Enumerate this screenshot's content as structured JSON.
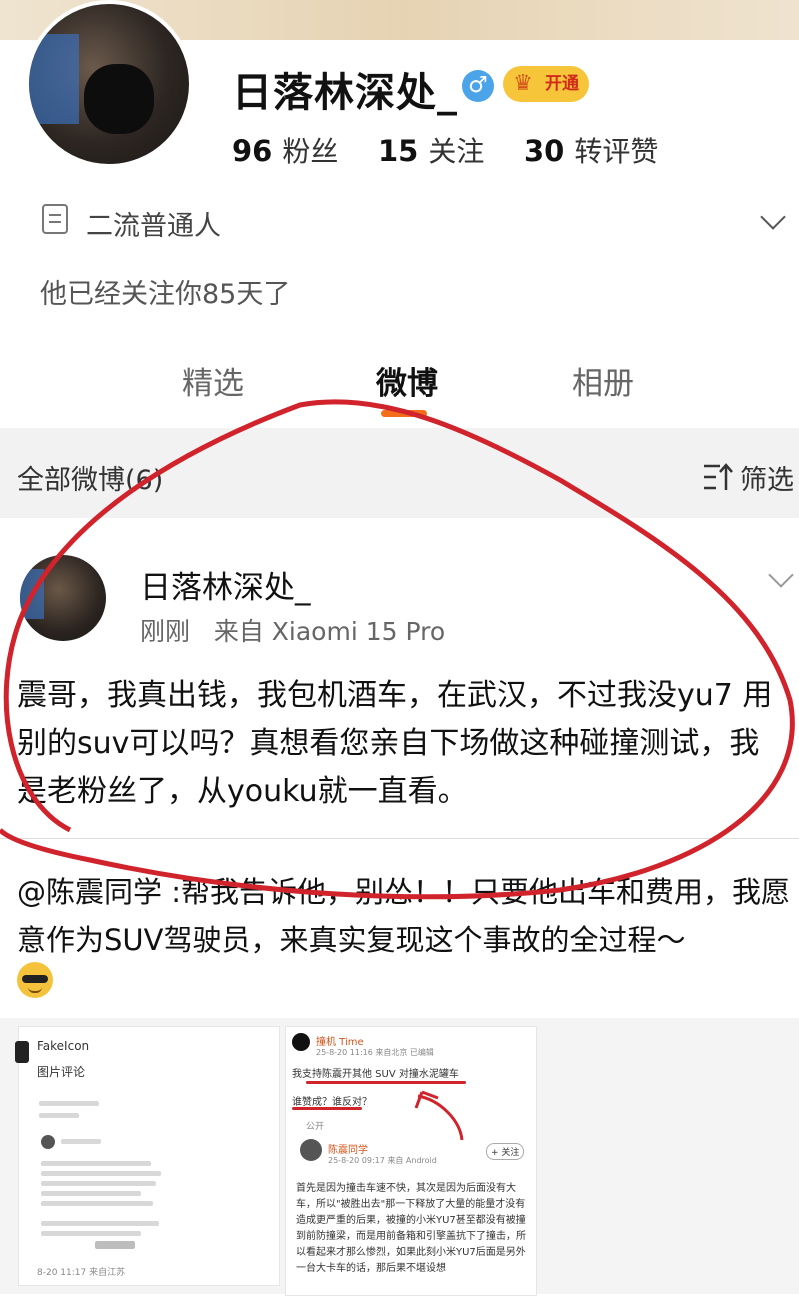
{
  "profile": {
    "username": "日落林深处_",
    "gender_icon": "male-icon",
    "vip_label": "开通",
    "stats": [
      {
        "count": "96",
        "label": "粉丝"
      },
      {
        "count": "15",
        "label": "关注"
      },
      {
        "count": "30",
        "label": "转评赞"
      }
    ],
    "bio": "二流普通人",
    "follow_note": "他已经关注你85天了"
  },
  "tabs": [
    {
      "label": "精选",
      "active": false
    },
    {
      "label": "微博",
      "active": true
    },
    {
      "label": "相册",
      "active": false
    }
  ],
  "feed": {
    "all_label": "全部微博(6)",
    "filter_label": "筛选"
  },
  "post": {
    "user": "日落林深处_",
    "meta": "刚刚   来自 Xiaomi 15 Pro",
    "text": "震哥，我真出钱，我包机酒车，在武汉，不过我没yu7 用别的suv可以吗？真想看您亲自下场做这种碰撞测试，我是老粉丝了，从youku就一直看。"
  },
  "repost": {
    "text": "@陈震同学 :帮我告诉他，别怂！！只要他出车和费用，我愿意作为SUV驾驶员，来真实复现这个事故的全过程～"
  },
  "media": {
    "shot1": {
      "user": "FakeIcon",
      "title": "图片评论",
      "footer": "8-20 11:17  来自江苏"
    },
    "shot2": {
      "user": "撞机 Time",
      "meta": "25-8-20 11:16  来自北京  已编辑",
      "line1": "我支持陈震开其他 SUV 对撞水泥罐车",
      "line2": "谁赞成？谁反对？",
      "public_label": "公开",
      "reply_user": "陈震同学",
      "reply_meta": "25-8-20 09:17  来自 Android",
      "follow_label": "+ 关注",
      "body": "首先是因为撞击车速不快，其次是因为后面没有大车，所以\"被胜出去\"那一下释放了大量的能量才没有造成更严重的后果，被撞的小米YU7甚至都没有被撞到前防撞梁，而是用前备箱和引擎盖抗下了撞击，所以看起来才那么惨烈，如果此刻小米YU7后面是另外一台大卡车的话，那后果不堪设想"
    }
  },
  "colors": {
    "accent": "#f36d1b",
    "annotation": "#d0232b",
    "vip_gold": "#f6c53a",
    "gender_blue": "#4ba3e8"
  }
}
